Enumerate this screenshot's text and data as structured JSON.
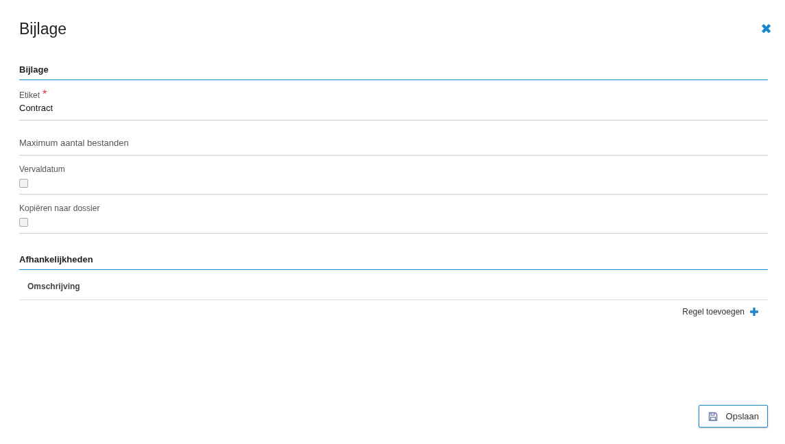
{
  "dialog": {
    "title": "Bijlage",
    "close": "✖"
  },
  "sections": [
    {
      "title": "Bijlage",
      "fields": [
        {
          "kind": "text",
          "label": "Etiket",
          "required_mark": "*",
          "value": "Contract"
        },
        {
          "kind": "input",
          "placeholder": "Maximum aantal bestanden"
        },
        {
          "kind": "checkbox",
          "label": "Vervaldatum",
          "checked": false
        },
        {
          "kind": "checkbox",
          "label": "Kopiëren naar dossier",
          "checked": false
        }
      ]
    },
    {
      "title": "Afhankelijkheden",
      "table": {
        "columns": [
          "Omschrijving"
        ]
      },
      "add_row": "Regel toevoegen"
    }
  ],
  "save_button": "Opslaan"
}
